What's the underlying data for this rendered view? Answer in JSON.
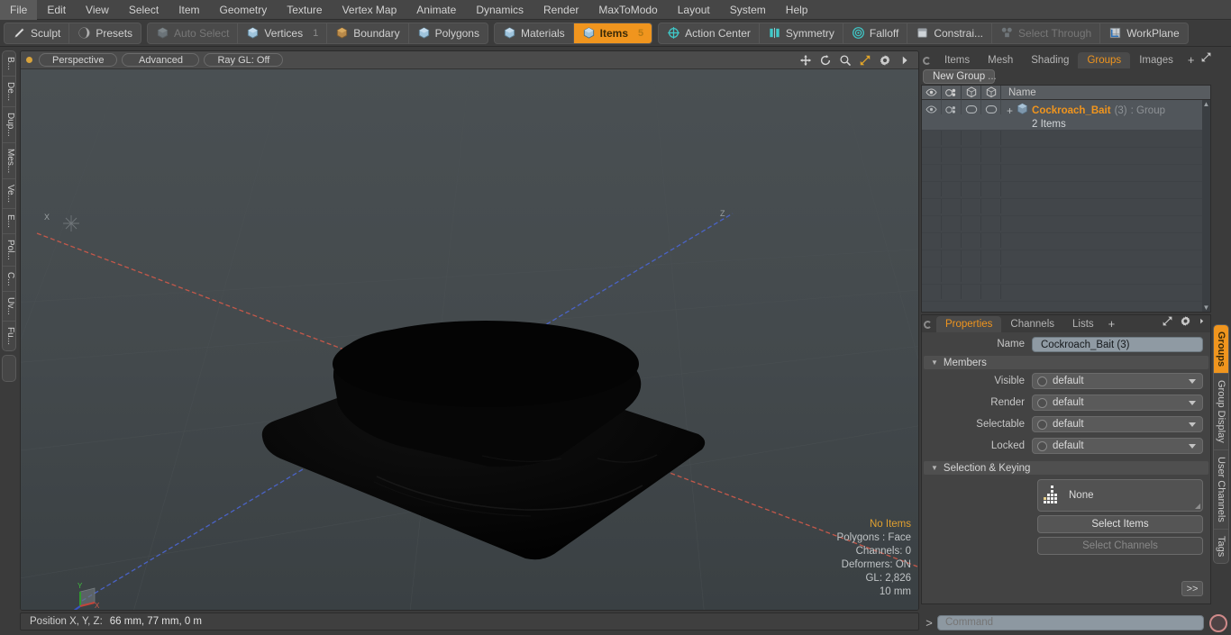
{
  "menu": {
    "items": [
      "File",
      "Edit",
      "View",
      "Select",
      "Item",
      "Geometry",
      "Texture",
      "Vertex Map",
      "Animate",
      "Dynamics",
      "Render",
      "MaxToModo",
      "Layout",
      "System",
      "Help"
    ]
  },
  "toolbar": {
    "group1": [
      {
        "label": "Sculpt",
        "icon": "pencil-icon",
        "state": "normal"
      },
      {
        "label": "Presets",
        "icon": "sphere-icon",
        "state": "normal"
      }
    ],
    "group2": [
      {
        "label": "Auto Select",
        "icon": "cube-icon",
        "state": "disabled",
        "count": ""
      },
      {
        "label": "Vertices",
        "icon": "cube-icon",
        "state": "normal",
        "count": "1"
      },
      {
        "label": "Boundary",
        "icon": "cube-icon",
        "state": "normal",
        "count": ""
      },
      {
        "label": "Polygons",
        "icon": "cube-icon",
        "state": "normal",
        "count": ""
      }
    ],
    "group3": [
      {
        "label": "Materials",
        "icon": "cube-icon",
        "state": "normal",
        "count": ""
      },
      {
        "label": "Items",
        "icon": "cube-icon",
        "state": "active",
        "count": "5"
      }
    ],
    "group4": [
      {
        "label": "Action Center",
        "icon": "crosshair-icon",
        "state": "normal"
      },
      {
        "label": "Symmetry",
        "icon": "symmetry-icon",
        "state": "normal"
      },
      {
        "label": "Falloff",
        "icon": "target-icon",
        "state": "normal"
      },
      {
        "label": "Constrai...",
        "icon": "square-icon",
        "state": "normal"
      },
      {
        "label": "Select Through",
        "icon": "selectthrough-icon",
        "state": "disabled"
      },
      {
        "label": "WorkPlane",
        "icon": "workplane-icon",
        "state": "normal"
      }
    ]
  },
  "left_strip": {
    "tabs": [
      "B...",
      "De...",
      "Dup...",
      "Mes...",
      "Ve...",
      "E...",
      "Pol...",
      "C...",
      "Uv...",
      "Fu..."
    ]
  },
  "viewport": {
    "pills": [
      "Perspective",
      "Advanced",
      "Ray GL: Off"
    ],
    "header_icons": [
      "move-icon",
      "rotate-icon",
      "zoom-icon",
      "fit-icon",
      "gear-icon",
      "chevron-right-icon"
    ],
    "stats": {
      "selection": "No Items",
      "polygons": "Polygons : Face",
      "channels": "Channels: 0",
      "deformers": "Deformers: ON",
      "gl": "GL: 2,826",
      "scale": "10 mm"
    },
    "axis_gizmo": {
      "x": "X",
      "y": "Y",
      "z": "Z"
    }
  },
  "position_bar": {
    "label": "Position X, Y, Z:",
    "value": "66 mm, 77 mm, 0 m"
  },
  "right_panel": {
    "tabs": [
      {
        "label": "Items",
        "active": false
      },
      {
        "label": "Mesh ...",
        "active": false
      },
      {
        "label": "Shading",
        "active": false
      },
      {
        "label": "Groups",
        "active": true
      },
      {
        "label": "Images",
        "active": false
      }
    ],
    "tab_plus": "+",
    "new_group_button": "New Group",
    "group_list": {
      "columns": [
        "eye-icon",
        "render-icon",
        "wireframe-icon",
        "shaded-icon"
      ],
      "name_header": "Name",
      "rows": [
        {
          "expander": "+",
          "title": "Cockroach_Bait",
          "count": "(3)",
          "type": ": Group",
          "sub": "2 Items",
          "selected": true
        }
      ]
    },
    "properties": {
      "tabs": [
        {
          "label": "Properties",
          "active": true
        },
        {
          "label": "Channels",
          "active": false
        },
        {
          "label": "Lists",
          "active": false
        }
      ],
      "tab_plus": "+",
      "name_label": "Name",
      "name_value": "Cockroach_Bait (3)",
      "members_section": "Members",
      "fields": [
        {
          "label": "Visible",
          "value": "default"
        },
        {
          "label": "Render",
          "value": "default"
        },
        {
          "label": "Selectable",
          "value": "default"
        },
        {
          "label": "Locked",
          "value": "default"
        }
      ],
      "selection_section": "Selection & Keying",
      "selection_value": "None",
      "select_items_button": "Select Items",
      "select_channels_button": "Select Channels",
      "expand_button": ">>"
    }
  },
  "right_strip": {
    "tabs": [
      {
        "label": "Groups",
        "active": true
      },
      {
        "label": "Group Display",
        "active": false
      },
      {
        "label": "User Channels",
        "active": false
      },
      {
        "label": "Tags",
        "active": false
      }
    ]
  },
  "command_bar": {
    "prompt": ">",
    "placeholder": "Command",
    "record_icon": "record-icon"
  },
  "colors": {
    "accent": "#f0951e",
    "panel_bg": "#3b3b3b",
    "viewport_bg": "#41474a",
    "axis_x": "#c45a4a",
    "axis_z": "#4a63c4",
    "axis_y": "#3faa3f",
    "field_bg": "#8f9aa3"
  }
}
